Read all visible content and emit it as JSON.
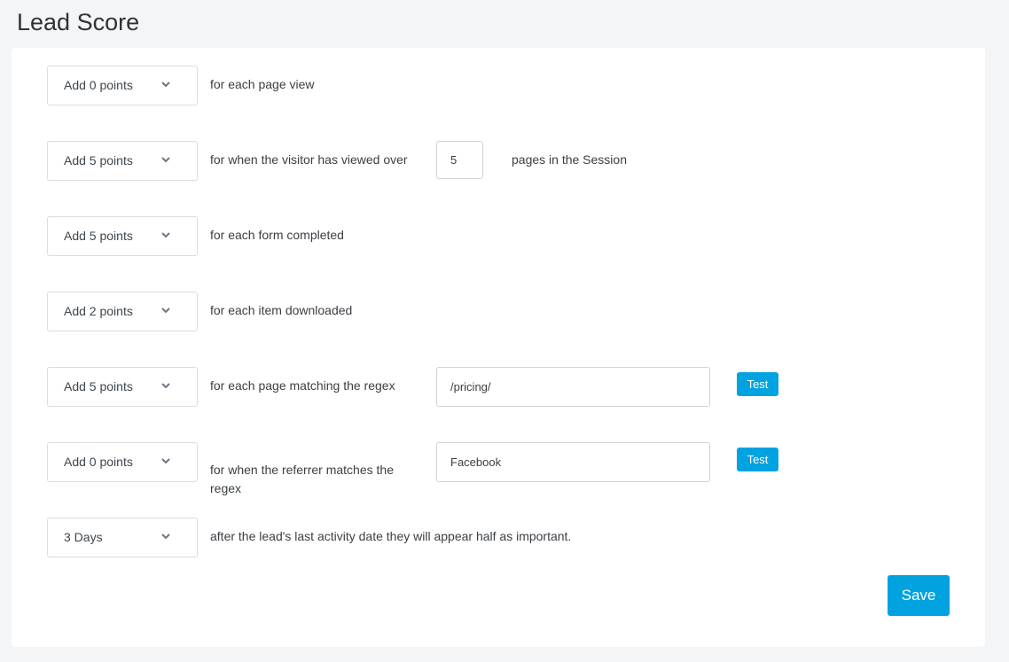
{
  "page": {
    "title": "Lead Score"
  },
  "rules": [
    {
      "select_value": "Add 0 points",
      "label": "for each page view"
    },
    {
      "select_value": "Add 5 points",
      "label": "for when the visitor has viewed over",
      "input_value": "5",
      "suffix": "pages in the Session"
    },
    {
      "select_value": "Add 5 points",
      "label": "for each form completed"
    },
    {
      "select_value": "Add 2 points",
      "label": "for each item downloaded"
    },
    {
      "select_value": "Add 5 points",
      "label": "for each page matching the regex",
      "input_value": "/pricing/",
      "button": "Test"
    },
    {
      "select_value": "Add 0 points",
      "label": "for when the referrer matches the regex",
      "input_value": "Facebook",
      "button": "Test"
    },
    {
      "select_value": "3 Days",
      "label": "after the lead's last activity date they will appear half as important."
    }
  ],
  "actions": {
    "save_label": "Save"
  },
  "icons": {
    "dropdown": "chevron-down-icon"
  },
  "colors": {
    "accent": "#00a3e0",
    "background": "#f4f5f7",
    "card": "#ffffff"
  }
}
